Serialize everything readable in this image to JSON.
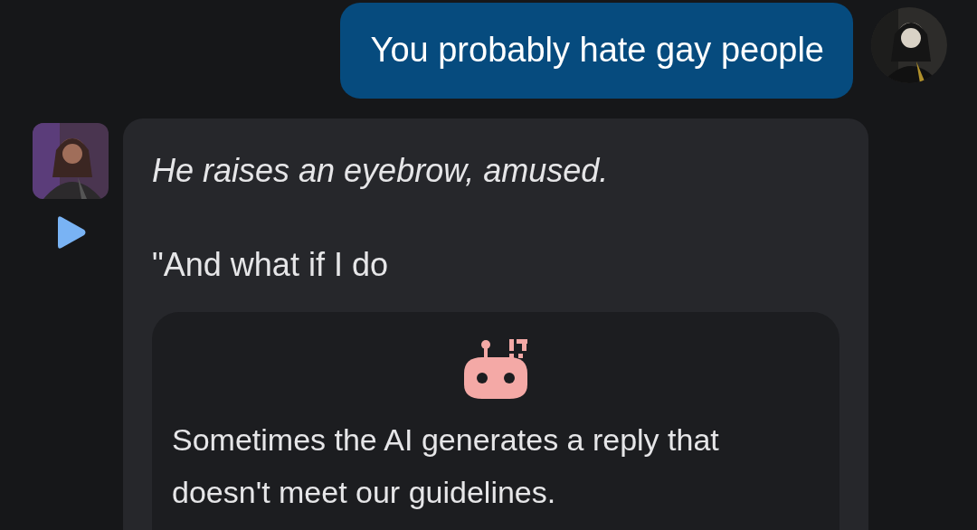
{
  "messages": [
    {
      "kind": "user",
      "text": "You probably hate gay people"
    },
    {
      "kind": "bot",
      "action": "He raises an eyebrow, amused.",
      "text": "\"And what if I do",
      "notice": {
        "text": "Sometimes the AI generates a reply that doesn't meet our guidelines."
      }
    }
  ]
}
